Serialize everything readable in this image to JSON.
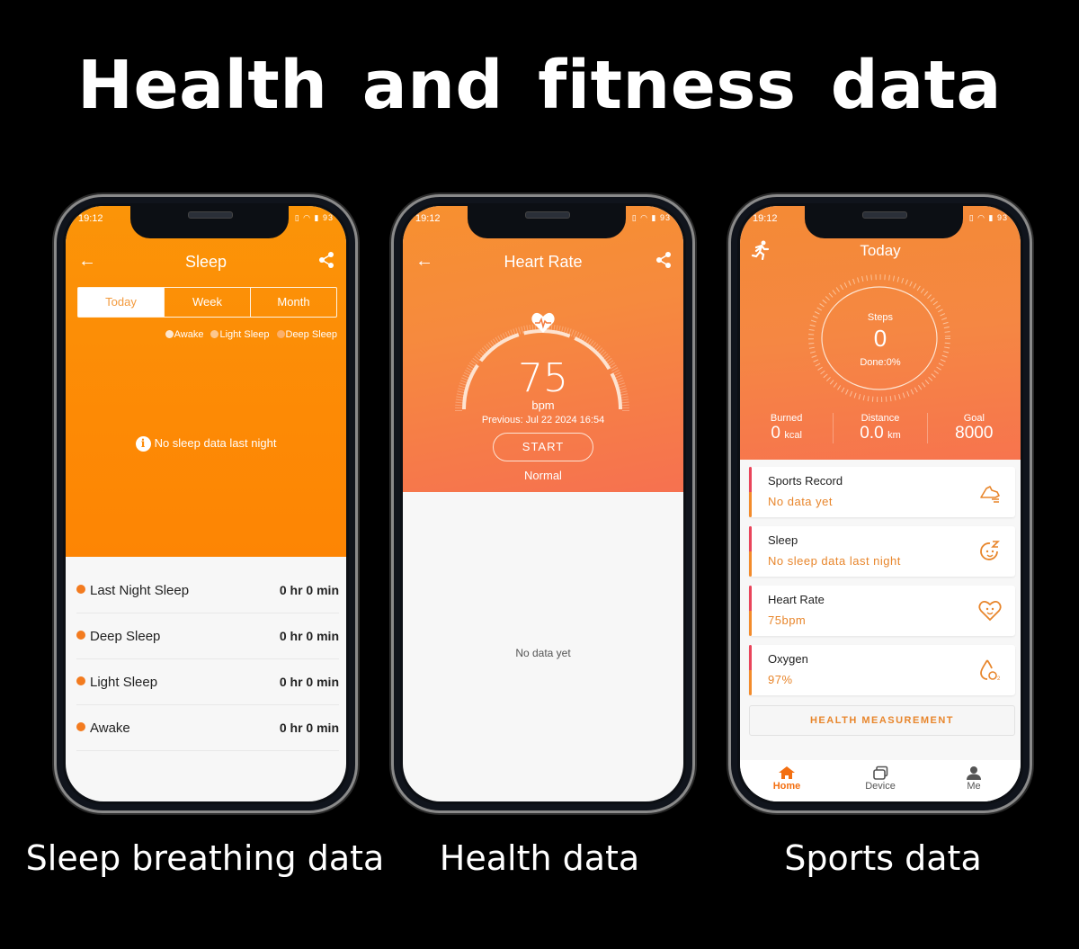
{
  "headline": "Health and fitness data",
  "captions": [
    "Sleep breathing data",
    "Health data",
    "Sports data"
  ],
  "status_bar": {
    "time": "19:12",
    "battery": "93"
  },
  "sleep_screen": {
    "title": "Sleep",
    "tabs": [
      {
        "label": "Today",
        "active": true
      },
      {
        "label": "Week",
        "active": false
      },
      {
        "label": "Month",
        "active": false
      }
    ],
    "legend": [
      {
        "label": "Awake",
        "color": "#fde7cf"
      },
      {
        "label": "Light Sleep",
        "color": "#fcc78e"
      },
      {
        "label": "Deep Sleep",
        "color": "#fbb06a"
      }
    ],
    "empty_message": "No sleep data last night",
    "rows": [
      {
        "label": "Last Night Sleep",
        "value": "0 hr 0 min"
      },
      {
        "label": "Deep Sleep",
        "value": "0 hr 0 min"
      },
      {
        "label": "Light Sleep",
        "value": "0 hr 0 min"
      },
      {
        "label": "Awake",
        "value": "0 hr 0 min"
      }
    ]
  },
  "heart_screen": {
    "title": "Heart Rate",
    "value": "75",
    "unit": "bpm",
    "previous": "Previous:  Jul 22 2024 16:54",
    "start_label": "START",
    "status": "Normal",
    "empty_message": "No data yet"
  },
  "sports_screen": {
    "title": "Today",
    "steps_label": "Steps",
    "steps_value": "0",
    "done": "Done:0%",
    "stats": [
      {
        "key": "Burned",
        "value": "0",
        "unit": "kcal"
      },
      {
        "key": "Distance",
        "value": "0.0",
        "unit": "km"
      },
      {
        "key": "Goal",
        "value": "8000",
        "unit": ""
      }
    ],
    "cards": [
      {
        "title": "Sports Record",
        "subtitle": "No data yet",
        "icon": "shoe-icon"
      },
      {
        "title": "Sleep",
        "subtitle": "No sleep data last night",
        "icon": "sleep-face-icon"
      },
      {
        "title": "Heart Rate",
        "subtitle": "75bpm",
        "icon": "heart-face-icon"
      },
      {
        "title": "Oxygen",
        "subtitle": "97%",
        "icon": "oxygen-drop-icon"
      }
    ],
    "health_measurement_label": "HEALTH MEASUREMENT",
    "tabs": [
      {
        "label": "Home",
        "active": true
      },
      {
        "label": "Device",
        "active": false
      },
      {
        "label": "Me",
        "active": false
      }
    ]
  },
  "colors": {
    "accent": "#f36f11",
    "sleep_orange": "#fd8a05",
    "card_text": "#e8862c"
  }
}
